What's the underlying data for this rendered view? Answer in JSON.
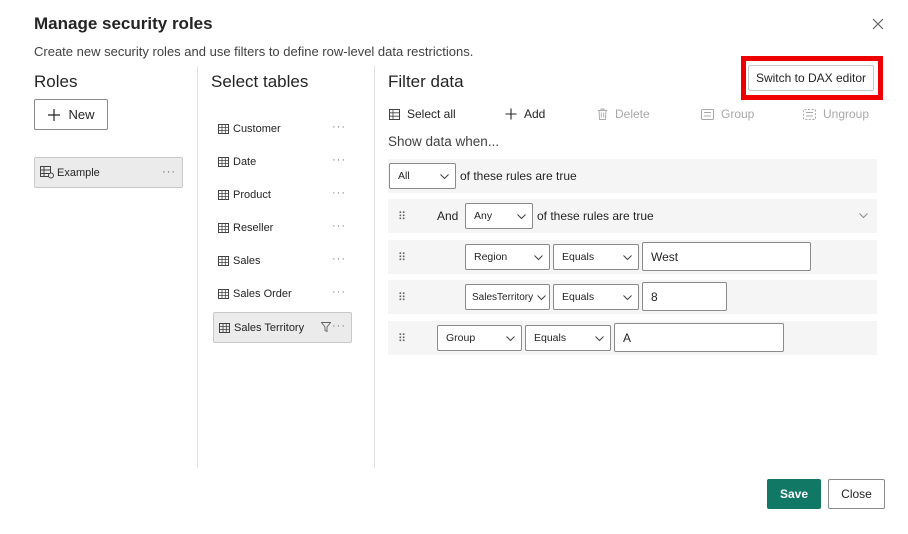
{
  "dialog": {
    "title": "Manage security roles",
    "subtitle": "Create new security roles and use filters to define row-level data restrictions."
  },
  "roles": {
    "heading": "Roles",
    "new_label": "New",
    "items": [
      {
        "label": "Example"
      }
    ]
  },
  "tables": {
    "heading": "Select tables",
    "items": [
      {
        "label": "Customer"
      },
      {
        "label": "Date"
      },
      {
        "label": "Product"
      },
      {
        "label": "Reseller"
      },
      {
        "label": "Sales"
      },
      {
        "label": "Sales Order"
      },
      {
        "label": "Sales Territory"
      }
    ],
    "selected": "Sales Territory"
  },
  "filter": {
    "heading": "Filter data",
    "dax_button": "Switch to DAX editor",
    "toolbar": {
      "select_all": "Select all",
      "add": "Add",
      "delete": "Delete",
      "group": "Group",
      "ungroup": "Ungroup"
    },
    "show_when": "Show data when...",
    "top_condition": {
      "quantifier": "All",
      "suffix": "of these rules are true"
    },
    "group_row": {
      "connector": "And",
      "quantifier": "Any",
      "suffix": "of these rules are true"
    },
    "rules": [
      {
        "column": "Region",
        "operator": "Equals",
        "value": "West"
      },
      {
        "column": "SalesTerritory",
        "operator": "Equals",
        "value": "8"
      },
      {
        "column": "Group",
        "operator": "Equals",
        "value": "A"
      }
    ]
  },
  "footer": {
    "save_label": "Save",
    "close_label": "Close"
  },
  "colors": {
    "accent_green": "#117865",
    "highlight_red": "#ee0000"
  }
}
